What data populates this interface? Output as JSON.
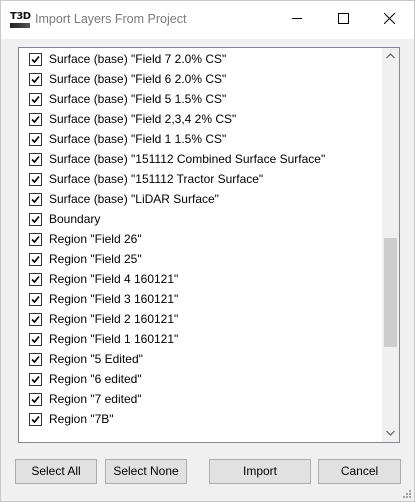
{
  "window": {
    "title": "Import Layers From Project",
    "app_icon_text": "T3D",
    "controls": [
      "minimize-icon",
      "maximize-icon",
      "close-icon"
    ]
  },
  "layers": [
    {
      "label": "Surface (base) \"Field 7 2.0% CS\"",
      "checked": true
    },
    {
      "label": "Surface (base) \"Field 6 2.0% CS\"",
      "checked": true
    },
    {
      "label": "Surface (base) \"Field 5 1.5% CS\"",
      "checked": true
    },
    {
      "label": "Surface (base) \"Field 2,3,4 2% CS\"",
      "checked": true
    },
    {
      "label": "Surface (base) \"Field 1 1.5% CS\"",
      "checked": true
    },
    {
      "label": "Surface (base) \"151112 Combined Surface Surface\"",
      "checked": true
    },
    {
      "label": "Surface (base) \"151112 Tractor Surface\"",
      "checked": true
    },
    {
      "label": "Surface (base) \"LiDAR Surface\"",
      "checked": true
    },
    {
      "label": "Boundary",
      "checked": true
    },
    {
      "label": "Region \"Field 26\"",
      "checked": true
    },
    {
      "label": "Region \"Field 25\"",
      "checked": true
    },
    {
      "label": "Region \"Field 4 160121\"",
      "checked": true
    },
    {
      "label": "Region \"Field 3 160121\"",
      "checked": true
    },
    {
      "label": "Region \"Field 2 160121\"",
      "checked": true
    },
    {
      "label": "Region \"Field 1 160121\"",
      "checked": true
    },
    {
      "label": "Region \"5 Edited\"",
      "checked": true
    },
    {
      "label": "Region \"6 edited\"",
      "checked": true
    },
    {
      "label": "Region \"7 edited\"",
      "checked": true
    },
    {
      "label": "Region \"7B\"",
      "checked": true
    }
  ],
  "buttons": {
    "select_all": "Select All",
    "select_none": "Select None",
    "import": "Import",
    "cancel": "Cancel"
  },
  "colors": {
    "window_bg": "#f0f0f0",
    "list_bg": "#ffffff",
    "button_bg": "#e1e1e1",
    "scroll_thumb": "#cdcdcd"
  }
}
